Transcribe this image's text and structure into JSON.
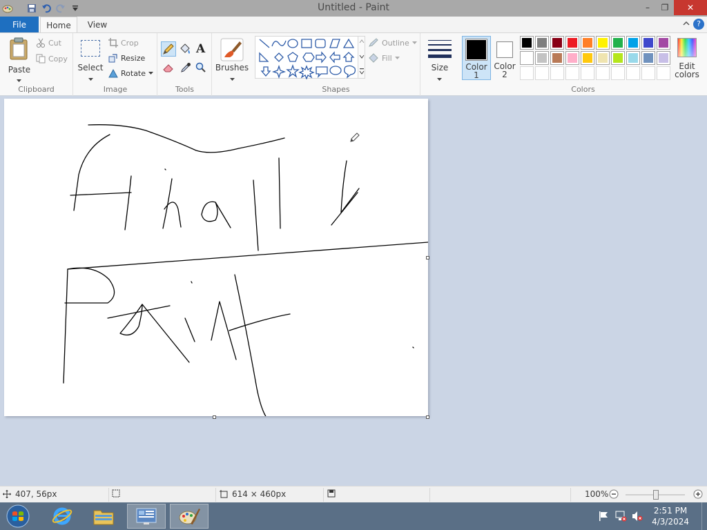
{
  "window": {
    "title": "Untitled - Paint",
    "controls": {
      "minimize": "–",
      "restore": "❐",
      "close": "✕"
    }
  },
  "tabs": {
    "file": "File",
    "home": "Home",
    "view": "View"
  },
  "ribbon": {
    "clipboard": {
      "label": "Clipboard",
      "paste": "Paste",
      "cut": "Cut",
      "copy": "Copy"
    },
    "image": {
      "label": "Image",
      "select": "Select",
      "crop": "Crop",
      "resize": "Resize",
      "rotate": "Rotate"
    },
    "tools": {
      "label": "Tools"
    },
    "brushes": {
      "label": "Brushes"
    },
    "shapes": {
      "label": "Shapes",
      "outline": "Outline",
      "fill": "Fill"
    },
    "size": {
      "label": "Size"
    },
    "colors": {
      "label": "Colors",
      "color1_label": "Color",
      "color1_num": "1",
      "color2_label": "Color",
      "color2_num": "2",
      "edit_label": "Edit",
      "edit_label2": "colors",
      "color1": "#000000",
      "color2": "#ffffff",
      "palette_row1": [
        "#000000",
        "#7f7f7f",
        "#880015",
        "#ed1c24",
        "#ff7f27",
        "#fff200",
        "#22b14c",
        "#00a2e8",
        "#3f48cc",
        "#a349a4"
      ],
      "palette_row2": [
        "#ffffff",
        "#c3c3c3",
        "#b97a57",
        "#ffaec9",
        "#ffc90e",
        "#efe4b0",
        "#b5e61d",
        "#99d9ea",
        "#7092be",
        "#c8bfe7"
      ]
    }
  },
  "status": {
    "cursor_pos": "407, 56px",
    "canvas_size": "614 × 460px",
    "zoom": "100%"
  },
  "taskbar": {
    "time": "2:51 PM",
    "date": "4/3/2024"
  }
}
